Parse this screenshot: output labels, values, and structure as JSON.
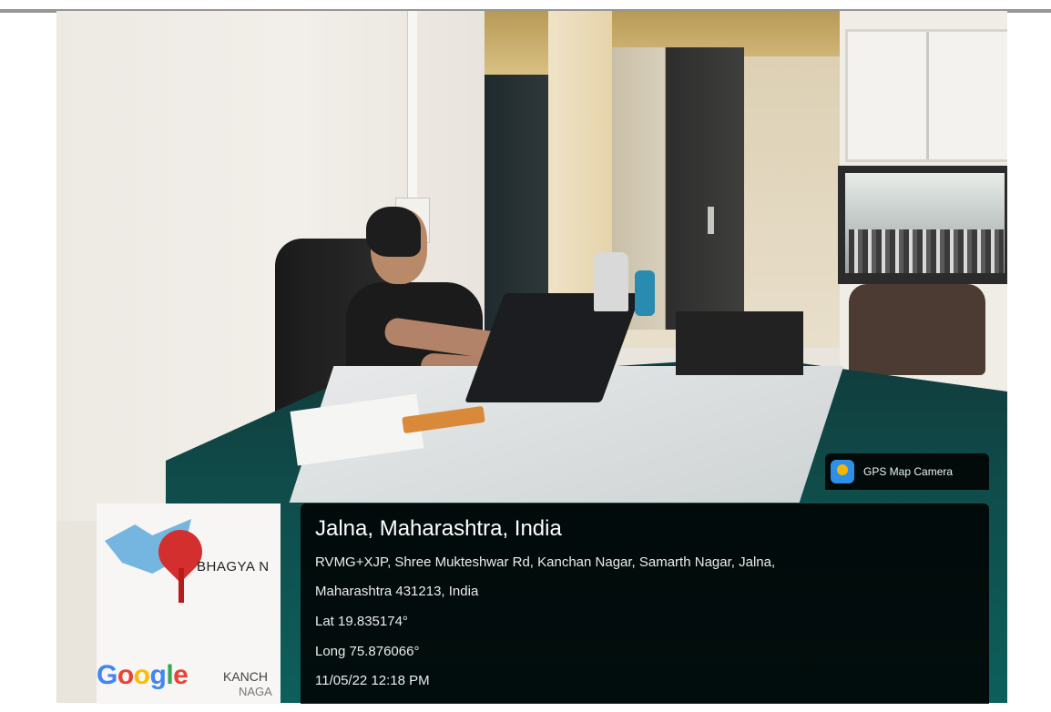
{
  "photo": {
    "description_tags": []
  },
  "gps_overlay": {
    "app_badge": {
      "icon": "gps-map-camera-icon",
      "label": "GPS Map Camera"
    },
    "location_title": "Jalna, Maharashtra, India",
    "address_line1": "RVMG+XJP, Shree Mukteshwar Rd, Kanchan Nagar, Samarth Nagar, Jalna,",
    "address_line2": "Maharashtra 431213, India",
    "latitude": "Lat 19.835174°",
    "longitude": "Long 75.876066°",
    "datetime": "11/05/22 12:18 PM"
  },
  "map_thumbnail": {
    "pin_icon": "location-pin-icon",
    "area_label": "BHAGYA N",
    "sub_label_1": "KANCH",
    "sub_label_2": "NAGA",
    "google_logo": "Google",
    "colors": {
      "pin": "#d32f2f",
      "water": "#75b6e0"
    }
  }
}
